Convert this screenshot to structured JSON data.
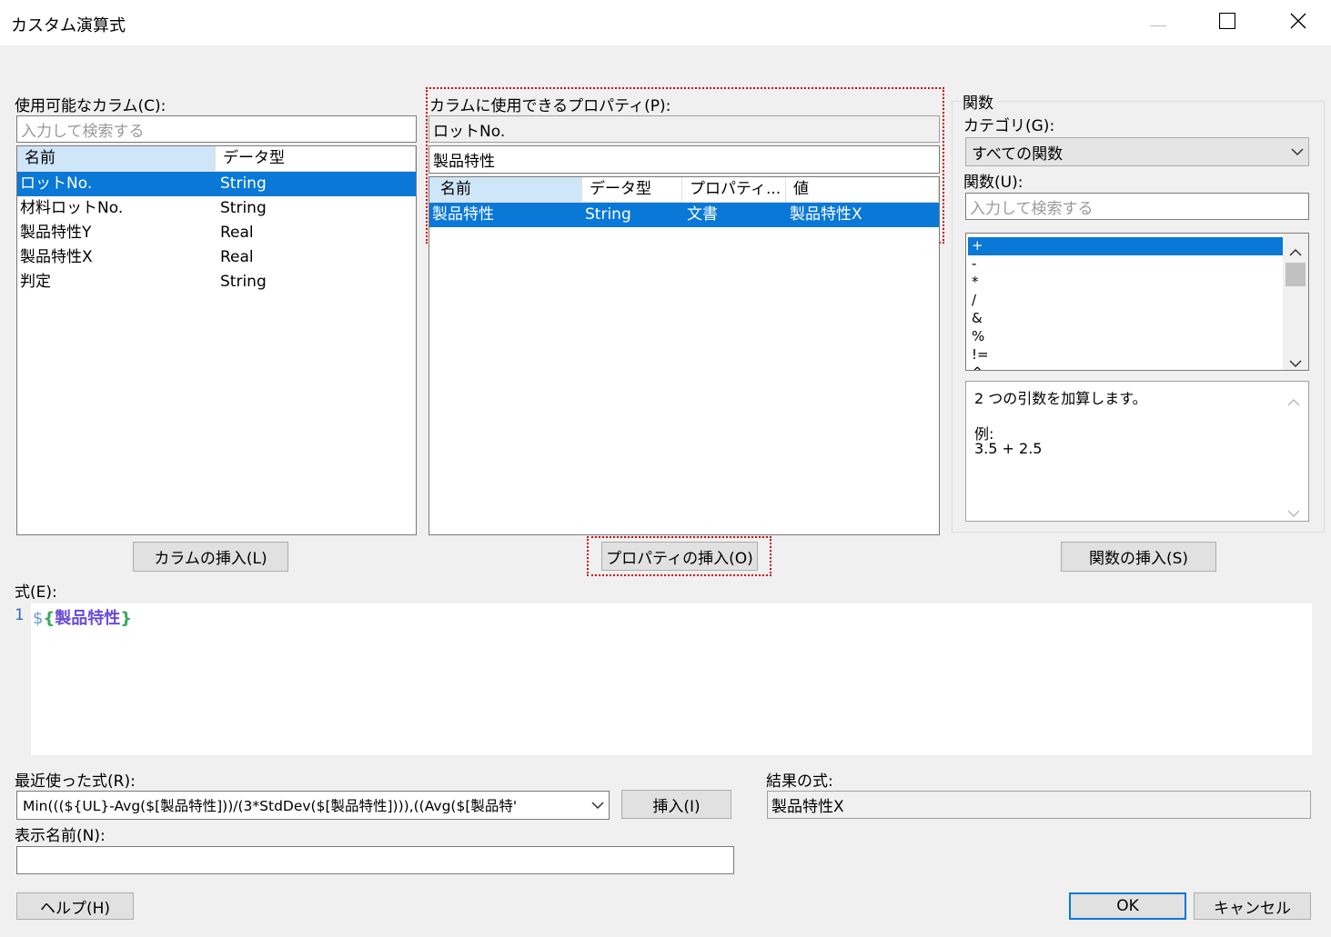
{
  "window": {
    "title": "カスタム演算式"
  },
  "columns_panel": {
    "label": "使用可能なカラム(C):",
    "search_placeholder": "入力して検索する",
    "headers": [
      "名前",
      "データ型"
    ],
    "rows": [
      {
        "name": "ロットNo.",
        "type": "String",
        "selected": true
      },
      {
        "name": "材料ロットNo.",
        "type": "String"
      },
      {
        "name": "製品特性Y",
        "type": "Real"
      },
      {
        "name": "製品特性X",
        "type": "Real"
      },
      {
        "name": "判定",
        "type": "String"
      }
    ],
    "insert_button": "カラムの挿入(L)"
  },
  "properties_panel": {
    "label": "カラムに使用できるプロパティ(P):",
    "selected_column": "ロットNo.",
    "search_value": "製品特性",
    "headers": [
      "名前",
      "データ型",
      "プロパティ...",
      "値"
    ],
    "rows": [
      {
        "name": "製品特性",
        "type": "String",
        "property": "文書",
        "value": "製品特性X",
        "selected": true
      }
    ],
    "insert_button": "プロパティの挿入(O)"
  },
  "functions_panel": {
    "group_label": "関数",
    "category_label": "カテゴリ(G):",
    "category_value": "すべての関数",
    "functions_label": "関数(U):",
    "search_placeholder": "入力して検索する",
    "items": [
      "+",
      "-",
      "*",
      "/",
      "&",
      "%",
      "!=",
      "^"
    ],
    "description_line1": "2 つの引数を加算します。",
    "description_example_label": "例:",
    "description_example": "3.5 + 2.5",
    "insert_button": "関数の挿入(S)"
  },
  "expression": {
    "label": "式(E):",
    "line_number": "1",
    "tok_dollar": "$",
    "tok_open": "{",
    "tok_name": "製品特性",
    "tok_close": "}"
  },
  "recent": {
    "label": "最近使った式(R):",
    "value": "Min(((${UL}-Avg($[製品特性]))/(3*StdDev($[製品特性]))),((Avg($[製品特'",
    "insert_button": "挿入(I)"
  },
  "result": {
    "label": "結果の式:",
    "value": "製品特性X"
  },
  "display_name": {
    "label": "表示名前(N):",
    "value": ""
  },
  "footer": {
    "help_button": "ヘルプ(H)",
    "ok_button": "OK",
    "cancel_button": "キャンセル"
  }
}
